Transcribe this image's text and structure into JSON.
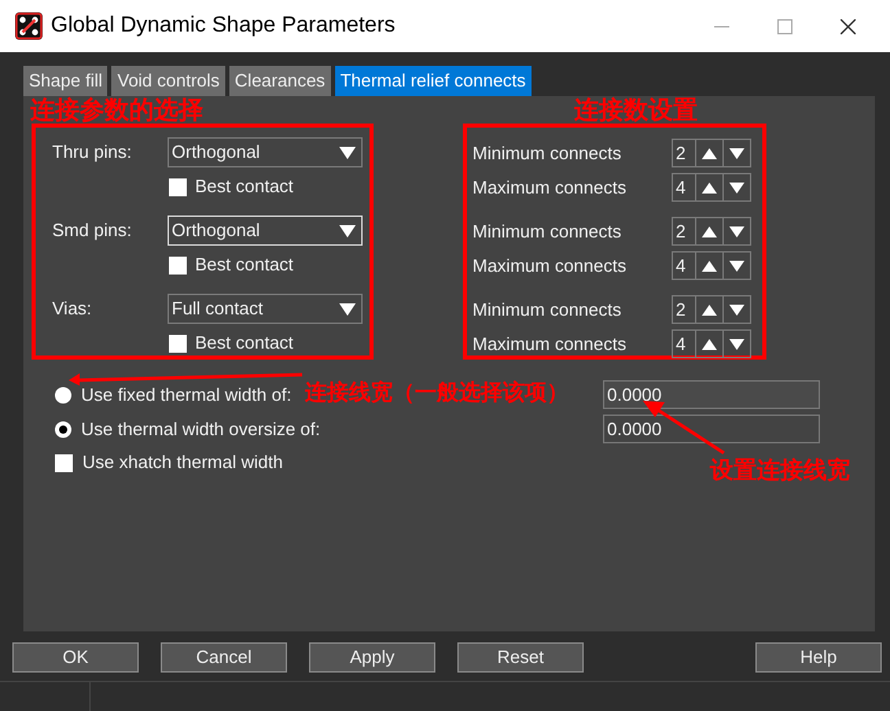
{
  "window": {
    "title": "Global Dynamic Shape Parameters"
  },
  "tabs": [
    {
      "label": "Shape fill",
      "selected": false
    },
    {
      "label": "Void controls",
      "selected": false
    },
    {
      "label": "Clearances",
      "selected": false
    },
    {
      "label": "Thermal relief connects",
      "selected": true
    }
  ],
  "pin_types": [
    {
      "label": "Thru pins:",
      "dropdown": "Orthogonal",
      "focused": false,
      "best_contact": {
        "label": "Best contact",
        "checked": false
      }
    },
    {
      "label": "Smd pins:",
      "dropdown": "Orthogonal",
      "focused": true,
      "best_contact": {
        "label": "Best contact",
        "checked": false
      }
    },
    {
      "label": "Vias:",
      "dropdown": "Full contact",
      "focused": false,
      "best_contact": {
        "label": "Best contact",
        "checked": false
      }
    }
  ],
  "connects": [
    {
      "label": "Minimum connects",
      "value": "2"
    },
    {
      "label": "Maximum connects",
      "value": "4"
    },
    {
      "label": "Minimum connects",
      "value": "2"
    },
    {
      "label": "Maximum connects",
      "value": "4"
    },
    {
      "label": "Minimum connects",
      "value": "2"
    },
    {
      "label": "Maximum connects",
      "value": "4"
    }
  ],
  "width_options": [
    {
      "label": "Use fixed thermal width of:",
      "selected": false,
      "value": "0.0000"
    },
    {
      "label": "Use thermal width oversize of:",
      "selected": true,
      "value": "0.0000"
    }
  ],
  "xhatch": {
    "label": "Use xhatch thermal width",
    "checked": false
  },
  "buttons": [
    "OK",
    "Cancel",
    "Apply",
    "Reset",
    "Help"
  ],
  "annotations": [
    "连接参数的选择",
    "连接数设置",
    "连接线宽（一般选择该项）",
    "设置连接线宽"
  ]
}
